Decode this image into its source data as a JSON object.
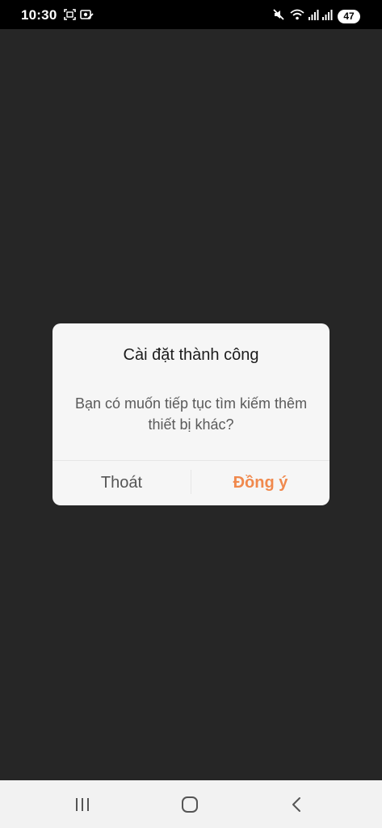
{
  "status_bar": {
    "time": "10:30",
    "battery": "47",
    "icons": [
      "screenshot-icon",
      "notification-icon",
      "mute-icon",
      "wifi-icon",
      "signal-icon",
      "signal-icon-2",
      "battery-icon"
    ]
  },
  "dialog": {
    "title": "Cài đặt thành công",
    "message": "Bạn có muốn tiếp tục tìm kiếm thêm thiết bị khác?",
    "cancel_label": "Thoát",
    "confirm_label": "Đồng ý"
  },
  "colors": {
    "background": "#262626",
    "dialog_bg": "#f6f6f6",
    "accent": "#f0894d"
  },
  "nav_bar": {
    "icons": [
      "recent-apps-icon",
      "home-icon",
      "back-icon"
    ]
  }
}
